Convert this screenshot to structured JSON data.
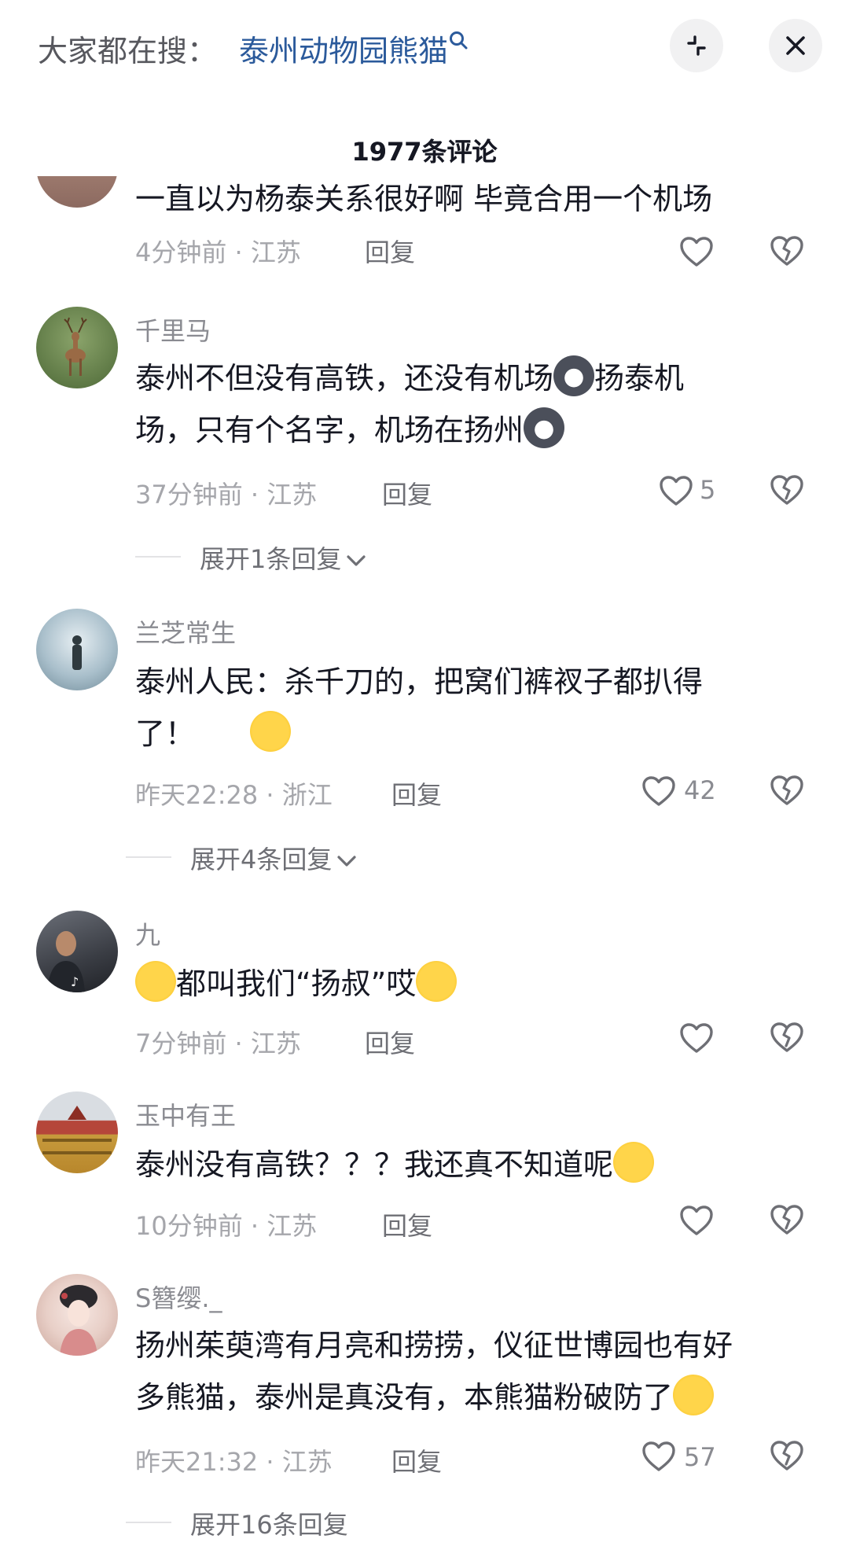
{
  "search": {
    "prefix": "大家都在搜：",
    "term": "泰州动物园熊猫"
  },
  "header": {
    "comment_count": "1977条评论"
  },
  "colors": {
    "link_blue": "#2b5a9b",
    "text_primary": "#161823",
    "text_secondary": "#a5a6ab",
    "button_bg": "#f1f1f2"
  },
  "comments": [
    {
      "username": "",
      "text": "一直以为杨泰关系很好啊 毕竟合用一个机场",
      "time": "4分钟前",
      "location": "江苏",
      "reply_label": "回复",
      "likes": ""
    },
    {
      "username": "千里马",
      "text_line1": "泰州不但没有高铁，还没有机场",
      "text_line1b": "扬泰机",
      "text_line2": "场，只有个名字，机场在扬州",
      "time": "37分钟前",
      "location": "江苏",
      "reply_label": "回复",
      "likes": "5",
      "expand_label": "展开1条回复"
    },
    {
      "username": "兰芝常生",
      "text_line1": "泰州人民：杀千刀的，把窝们裤衩子都扒得",
      "text_line2": "了！",
      "time": "昨天22:28",
      "location": "浙江",
      "reply_label": "回复",
      "likes": "42",
      "expand_label": "展开4条回复"
    },
    {
      "username": "九",
      "text": "都叫我们“扬叔”哎",
      "time": "7分钟前",
      "location": "江苏",
      "reply_label": "回复",
      "likes": ""
    },
    {
      "username": "玉中有王",
      "text": "泰州没有高铁？？？我还真不知道呢",
      "time": "10分钟前",
      "location": "江苏",
      "reply_label": "回复",
      "likes": ""
    },
    {
      "username": "S簪缨._",
      "text_line1": "扬州茱萸湾有月亮和捞捞，仪征世博园也有好",
      "text_line2": "多熊猫，泰州是真没有，本熊猫粉破防了",
      "time": "昨天21:32",
      "location": "江苏",
      "reply_label": "回复",
      "likes": "57",
      "expand_label": "展开16条回复"
    }
  ],
  "separator": " · "
}
